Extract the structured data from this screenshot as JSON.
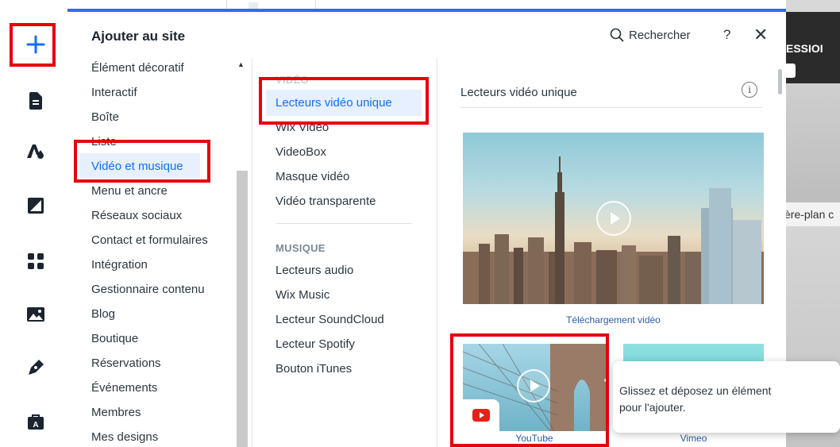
{
  "panel": {
    "title": "Ajouter au site",
    "search_label": "Rechercher",
    "help_label": "?",
    "close_label": "✕"
  },
  "rail": {
    "icons": [
      "add-icon",
      "pages-icon",
      "design-icon",
      "background-icon",
      "apps-icon",
      "media-icon",
      "blog-icon",
      "store-icon"
    ],
    "accent": "#116dff"
  },
  "categories": [
    "Élément décoratif",
    "Interactif",
    "Boîte",
    "Liste",
    "Vidéo et musique",
    "Menu et ancre",
    "Réseaux sociaux",
    "Contact et formulaires",
    "Intégration",
    "Gestionnaire contenu",
    "Blog",
    "Boutique",
    "Réservations",
    "Événements",
    "Membres",
    "Mes designs"
  ],
  "selected_category": "Vidéo et musique",
  "subcategories": {
    "video_heading": "VIDÉO",
    "video_items": [
      "Lecteurs vidéo unique",
      "Wix Video",
      "VideoBox",
      "Masque vidéo",
      "Vidéo transparente"
    ],
    "music_heading": "MUSIQUE",
    "music_items": [
      "Lecteurs audio",
      "Wix Music",
      "Lecteur SoundCloud",
      "Lecteur Spotify",
      "Bouton iTunes"
    ]
  },
  "content": {
    "section_title": "Lecteurs vidéo unique",
    "info_icon": "i",
    "items": [
      {
        "caption": "Téléchargement vidéo"
      },
      {
        "caption": "YouTube"
      },
      {
        "caption": "Vimeo"
      }
    ]
  },
  "tooltip": {
    "text_line1": "Glissez et déposez un élément",
    "text_line2": "pour l'ajouter."
  },
  "backdrop": {
    "fragment1": "ESSIOI",
    "fragment2": "ère-plan c"
  },
  "colors": {
    "highlight": "#e5000b",
    "selected_bg": "#e7f0ff",
    "selected_text": "#116dff",
    "topbar": "#2d6df0"
  }
}
